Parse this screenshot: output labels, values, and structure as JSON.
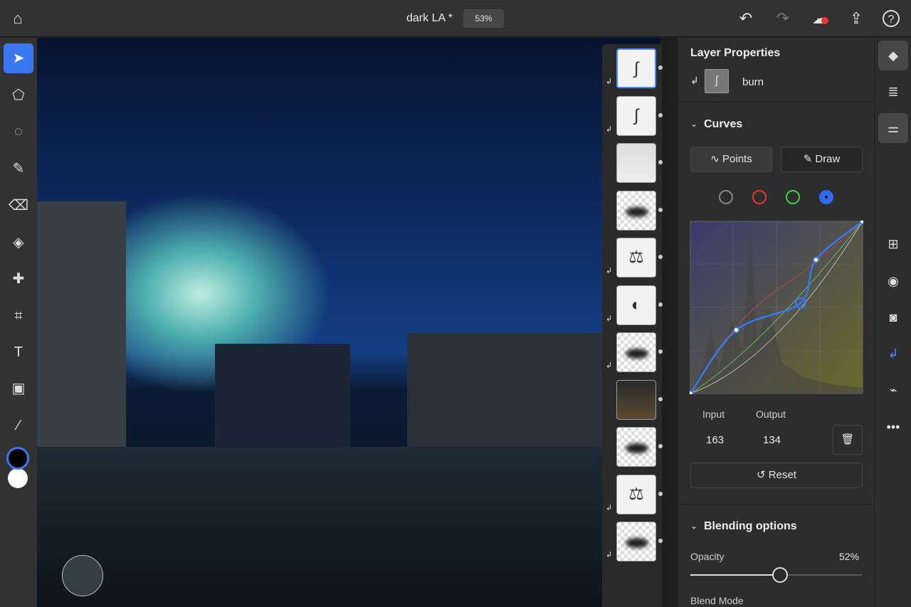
{
  "topbar": {
    "title": "dark LA *",
    "zoom": "53%",
    "icons": [
      "home-icon",
      "undo-icon",
      "redo-icon",
      "cloud-sync-error-icon",
      "share-icon",
      "help-icon"
    ]
  },
  "tools": [
    "select",
    "transform",
    "lasso",
    "brush",
    "eraser",
    "fill",
    "healing",
    "crop",
    "type",
    "place-image",
    "eyedropper"
  ],
  "colors": {
    "foreground": "#000000",
    "background": "#ffffff",
    "accent": "#3a78f2"
  },
  "layer_properties": {
    "title": "Layer Properties",
    "layer_name": "burn"
  },
  "curves": {
    "title": "Curves",
    "points_label": "Points",
    "draw_label": "Draw",
    "channels": [
      "rgb",
      "red",
      "green",
      "blue"
    ],
    "selected_channel": "blue",
    "input_label": "Input",
    "output_label": "Output",
    "input_value": "163",
    "output_value": "134",
    "reset_label": "Reset",
    "blue_curve_points": [
      [
        0,
        0
      ],
      [
        68,
        94
      ],
      [
        163,
        134
      ],
      [
        186,
        198
      ],
      [
        255,
        255
      ]
    ]
  },
  "blending": {
    "title": "Blending options",
    "opacity_label": "Opacity",
    "opacity_value": "52%",
    "opacity_fraction": 0.52,
    "blend_mode_label": "Blend Mode"
  }
}
